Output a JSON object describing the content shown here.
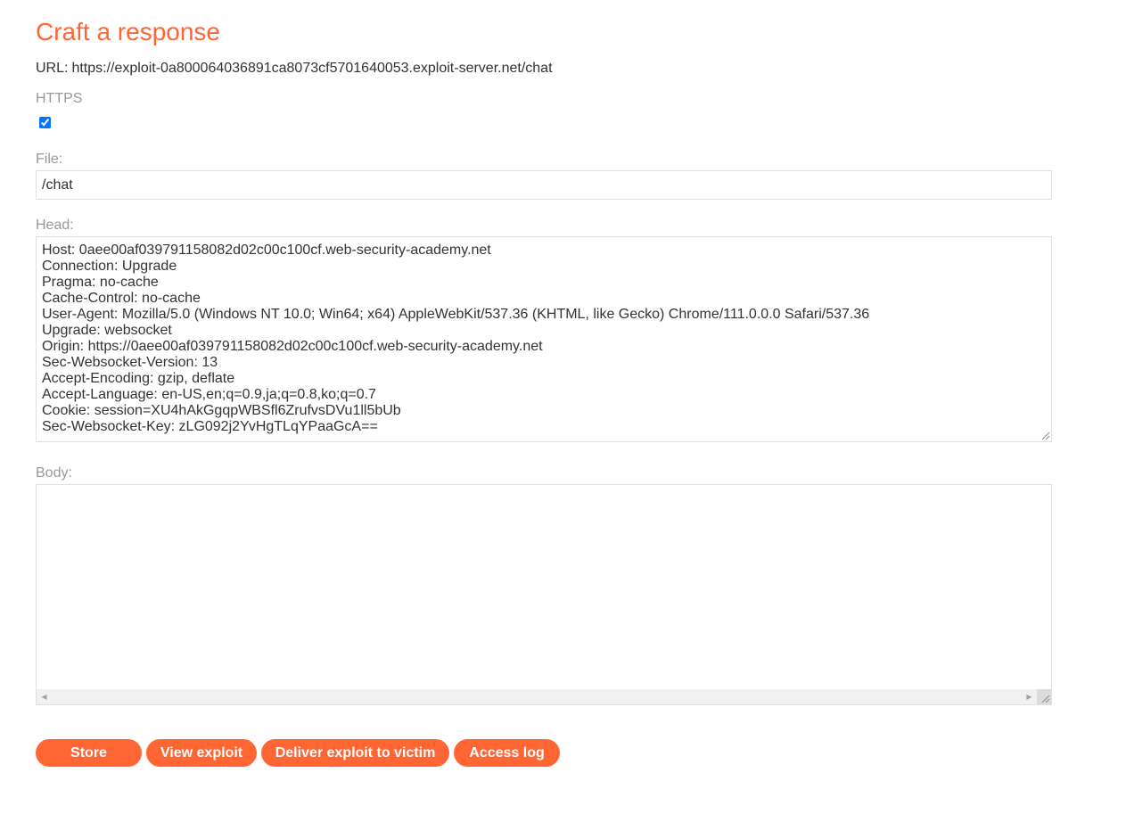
{
  "page": {
    "title": "Craft a response",
    "url_prefix": "URL:",
    "url_value": "https://exploit-0a800064036891ca8073cf5701640053.exploit-server.net/chat"
  },
  "form": {
    "https_label": "HTTPS",
    "https_checked": true,
    "file_label": "File:",
    "file_value": "/chat",
    "head_label": "Head:",
    "head_value": "Host: 0aee00af039791158082d02c00c100cf.web-security-academy.net\nConnection: Upgrade\nPragma: no-cache\nCache-Control: no-cache\nUser-Agent: Mozilla/5.0 (Windows NT 10.0; Win64; x64) AppleWebKit/537.36 (KHTML, like Gecko) Chrome/111.0.0.0 Safari/537.36\nUpgrade: websocket\nOrigin: https://0aee00af039791158082d02c00c100cf.web-security-academy.net\nSec-Websocket-Version: 13\nAccept-Encoding: gzip, deflate\nAccept-Language: en-US,en;q=0.9,ja;q=0.8,ko;q=0.7\nCookie: session=XU4hAkGgqpWBSfl6ZrufvsDVu1ll5bUb\nSec-Websocket-Key: zLG092j2YvHgTLqYPaaGcA==",
    "body_label": "Body:",
    "body_value": ""
  },
  "buttons": {
    "store": "Store",
    "view_exploit": "View exploit",
    "deliver": "Deliver exploit to victim",
    "access_log": "Access log"
  },
  "colors": {
    "accent": "#ff6633",
    "label": "#999999",
    "text": "#333333",
    "border": "#e0e0e0"
  }
}
